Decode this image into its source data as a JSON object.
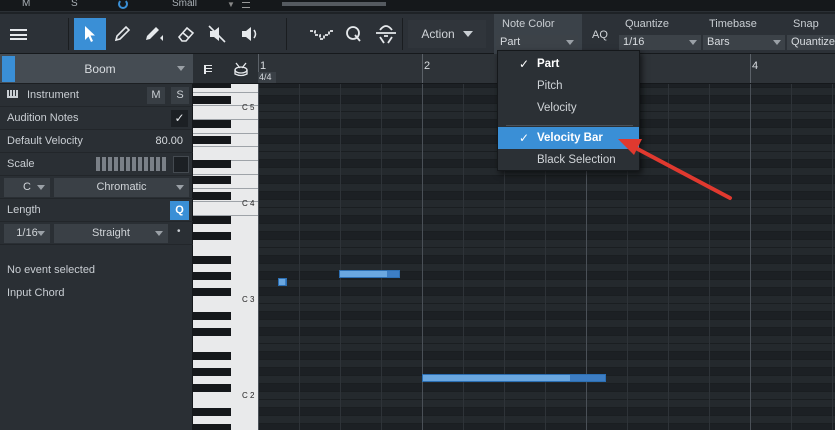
{
  "topstrip": {
    "m_label": "M",
    "s_label": "S",
    "size_label": "Small"
  },
  "toolbar": {
    "action_label": "Action",
    "aq_label": "AQ",
    "note_color": {
      "label": "Note Color",
      "value": "Part"
    },
    "quantize": {
      "label": "Quantize",
      "value": "1/16"
    },
    "timebase": {
      "label": "Timebase",
      "value": "Bars"
    },
    "snap": {
      "label": "Snap",
      "value": "Quantize"
    }
  },
  "inspector": {
    "track_name": "Boom",
    "instrument_label": "Instrument",
    "m_label": "M",
    "s_label": "S",
    "audition_notes_label": "Audition Notes",
    "audition_notes_checked": "✓",
    "default_velocity_label": "Default Velocity",
    "default_velocity_value": "80.00",
    "scale_label": "Scale",
    "scale_root": "C",
    "scale_type": "Chromatic",
    "length_label": "Length",
    "length_q": "Q",
    "length_value": "1/16",
    "length_mode": "Straight",
    "length_dot": "•",
    "no_event_label": "No event selected",
    "input_chord_label": "Input Chord"
  },
  "ruler": {
    "time_signature": "4/4",
    "bars": [
      "1",
      "2",
      "4"
    ]
  },
  "keyboard": {
    "labels": [
      "C 5",
      "C 4",
      "C 3",
      "C 2"
    ]
  },
  "dropdown": {
    "items": [
      {
        "label": "Part",
        "checked": "✓"
      },
      {
        "label": "Pitch"
      },
      {
        "label": "Velocity"
      },
      {
        "label": "Velocity Bar",
        "checked": "✓"
      },
      {
        "label": "Black Selection"
      }
    ]
  },
  "colors": {
    "accent": "#3a8fd6",
    "annotation_arrow": "#e0392f",
    "note": "#3d7ec4"
  }
}
